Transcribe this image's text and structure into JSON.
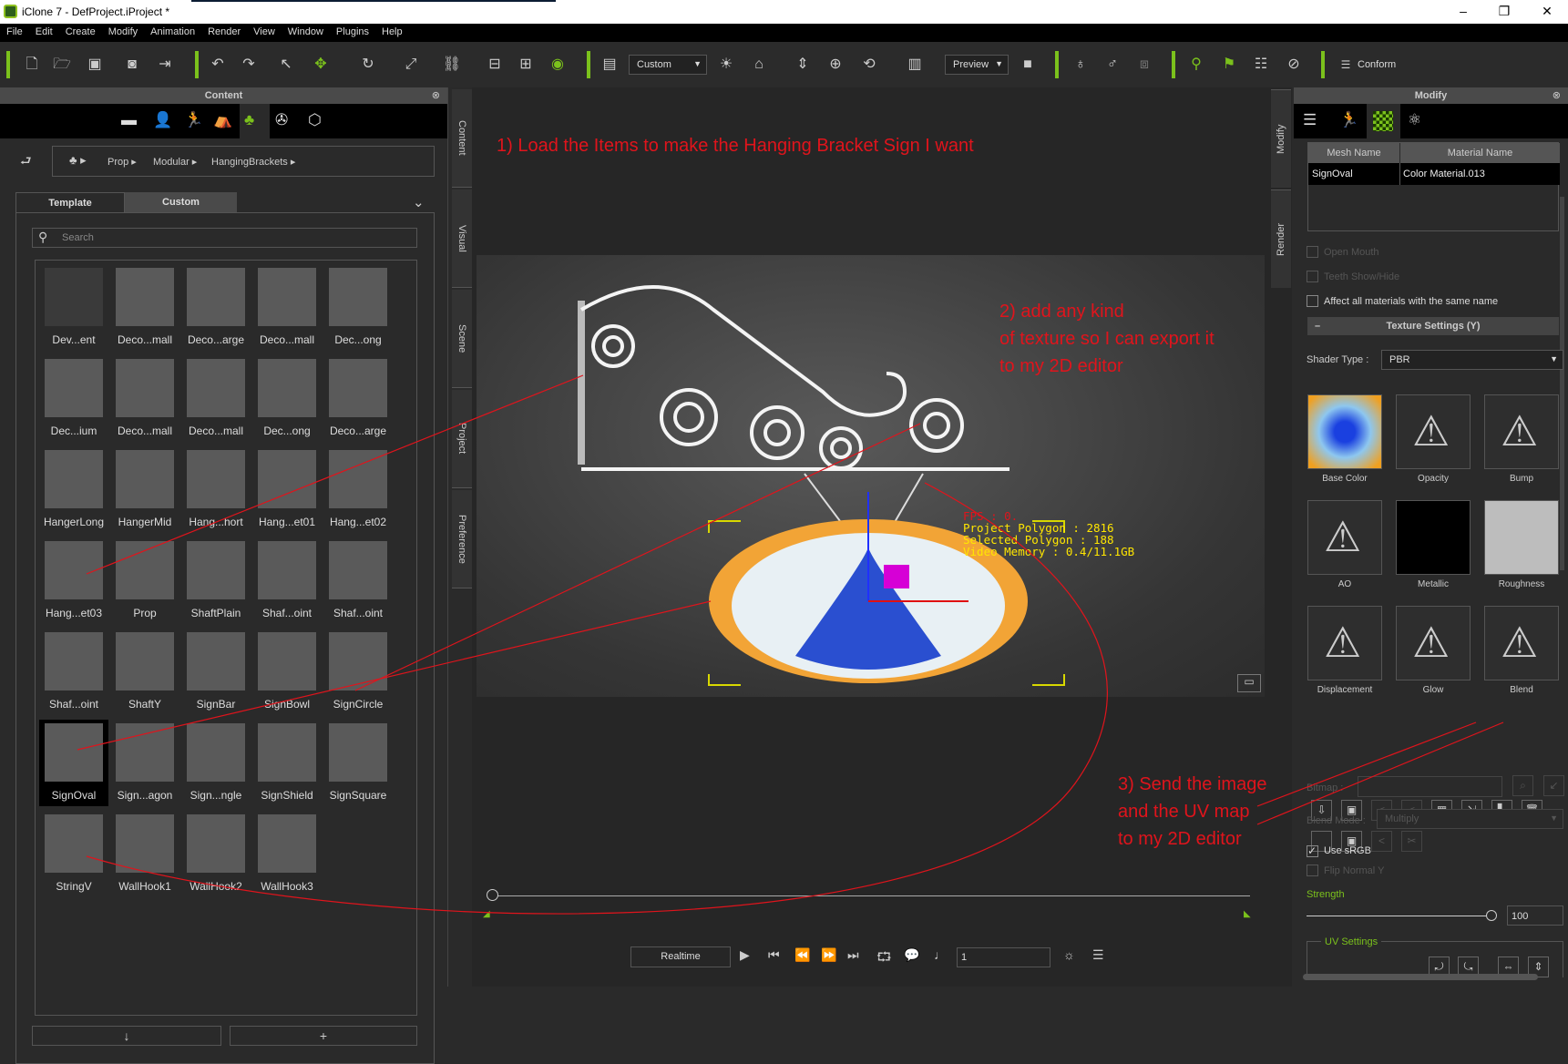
{
  "window": {
    "title": "iClone 7 - DefProject.iProject *",
    "minimize": "–",
    "restore": "❐",
    "close": "✕"
  },
  "menu": [
    "File",
    "Edit",
    "Create",
    "Modify",
    "Animation",
    "Render",
    "View",
    "Window",
    "Plugins",
    "Help"
  ],
  "toolbar": {
    "camera_dropdown": "Custom",
    "render_dropdown": "Preview",
    "conform": "Conform"
  },
  "content": {
    "title": "Content",
    "breadcrumb": [
      "Prop",
      "Modular",
      "HangingBrackets"
    ],
    "tabs": [
      "Template",
      "Custom"
    ],
    "search_placeholder": "Search",
    "items": [
      "Dev...ent",
      "Deco...mall",
      "Deco...arge",
      "Deco...mall",
      "Dec...ong",
      "Dec...ium",
      "Deco...mall",
      "Deco...mall",
      "Dec...ong",
      "Deco...arge",
      "HangerLong",
      "HangerMid",
      "Hang...hort",
      "Hang...et01",
      "Hang...et02",
      "Hang...et03",
      "Prop",
      "ShaftPlain",
      "Shaf...oint",
      "Shaf...oint",
      "Shaf...oint",
      "ShaftY",
      "SignBar",
      "SignBowl",
      "SignCircle",
      "SignOval",
      "Sign...agon",
      "Sign...ngle",
      "SignShield",
      "SignSquare",
      "StringV",
      "WallHook1",
      "WallHook2",
      "WallHook3"
    ],
    "selected_item": "SignOval",
    "down_button": "↓",
    "add_button": "+"
  },
  "side_tabs": [
    "Content",
    "Visual",
    "Scene",
    "Project",
    "Preference"
  ],
  "right_side_tabs": [
    "Modify",
    "Render"
  ],
  "viewport": {
    "fps": "FPS : 0.",
    "project_polygon": "Project Polygon : 2816",
    "selected_polygon": "Selected Polygon : 188",
    "video_memory": "Video Memory : 0.4/11.1GB",
    "annotation1": "1) Load the Items to make the Hanging Bracket Sign I want",
    "annotation2": [
      "2) add any kind",
      "of texture so I can export it",
      "to my 2D editor"
    ],
    "annotation3": [
      "3) Send the image",
      "and the UV map",
      "to my 2D editor"
    ]
  },
  "playback": {
    "mode": "Realtime",
    "frame": "1"
  },
  "modify": {
    "title": "Modify",
    "columns": [
      "Mesh Name",
      "Material Name"
    ],
    "row": [
      "SignOval",
      "Color Material.013"
    ],
    "open_mouth": "Open Mouth",
    "teeth": "Teeth Show/Hide",
    "affect_all": "Affect all materials with the same name",
    "texture_settings": "Texture Settings  (Y)",
    "shader_label": "Shader Type :",
    "shader_value": "PBR",
    "slots": [
      "Base Color",
      "Opacity",
      "Bump",
      "AO",
      "Metallic",
      "Roughness",
      "Displacement",
      "Glow",
      "Blend"
    ],
    "bitmap_label": "Bitmap :",
    "blend_mode_label": "Blend Mode :",
    "blend_mode_value": "Multiply",
    "use_srgb": "Use sRGB",
    "use_srgb_checked": true,
    "flip_normal": "Flip Normal Y",
    "strength_label": "Strength",
    "strength_value": "100",
    "uv_settings": "UV Settings"
  },
  "colors": {
    "accent": "#7bc11c",
    "annotation": "#e0141c",
    "stats": "#ffe600"
  }
}
